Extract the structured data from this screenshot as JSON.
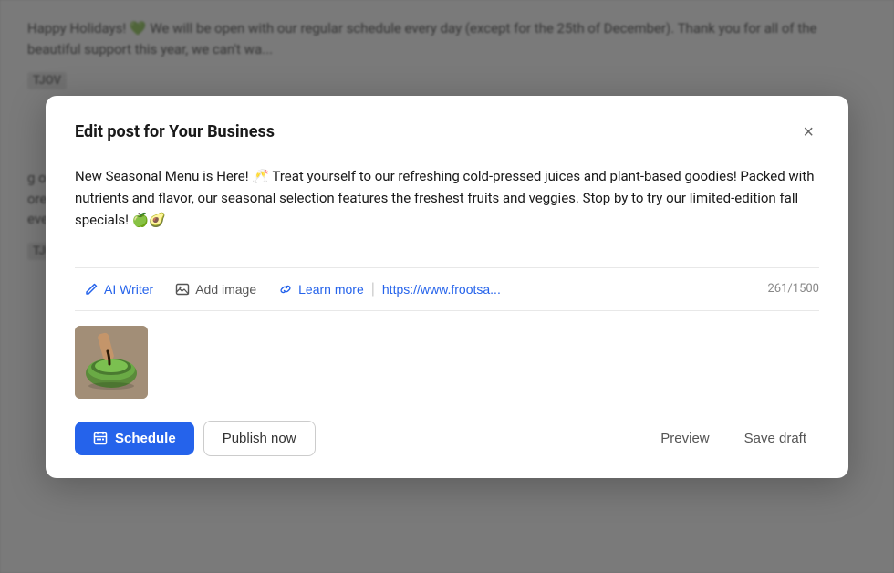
{
  "background": {
    "text1": "Happy Holidays! 💚 We will be open with our regular schedule every day (except for the 25th of December). Thank you for all of the beautiful support this year, we can't wa...",
    "label1": "TJOV",
    "text2": "g ove\nore \nevery",
    "label2": "TJOV"
  },
  "modal": {
    "title": "Edit post for Your Business",
    "close_label": "×",
    "post_text": "New Seasonal Menu is Here! 🥂 Treat yourself to our refreshing cold-pressed juices and plant-based goodies! Packed with nutrients and flavor, our seasonal selection features the freshest fruits and veggies. Stop by to try our limited-edition fall specials! 🍏🥑",
    "toolbar": {
      "ai_writer_label": "AI Writer",
      "add_image_label": "Add image",
      "learn_more_label": "Learn more",
      "link_url": "https://www.frootsa...",
      "char_count": "261/1500"
    },
    "footer": {
      "schedule_label": "Schedule",
      "publish_now_label": "Publish now",
      "preview_label": "Preview",
      "save_draft_label": "Save draft"
    }
  }
}
